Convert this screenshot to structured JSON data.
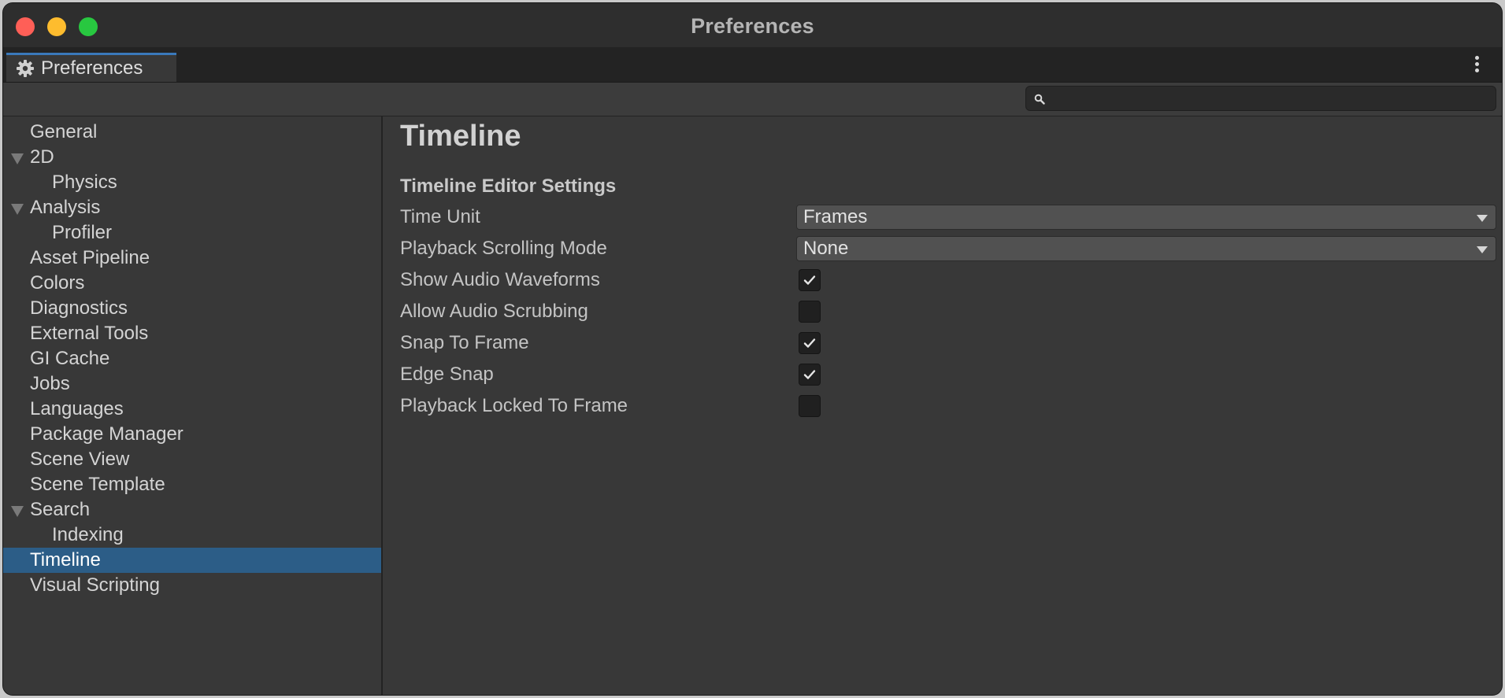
{
  "window": {
    "title": "Preferences"
  },
  "tab": {
    "label": "Preferences",
    "icon": "gear-icon"
  },
  "search": {
    "value": "",
    "placeholder": ""
  },
  "sidebar": {
    "items": [
      {
        "label": "General",
        "level": 0,
        "expandable": false,
        "selected": false
      },
      {
        "label": "2D",
        "level": 0,
        "expandable": true,
        "selected": false
      },
      {
        "label": "Physics",
        "level": 1,
        "expandable": false,
        "selected": false
      },
      {
        "label": "Analysis",
        "level": 0,
        "expandable": true,
        "selected": false
      },
      {
        "label": "Profiler",
        "level": 1,
        "expandable": false,
        "selected": false
      },
      {
        "label": "Asset Pipeline",
        "level": 0,
        "expandable": false,
        "selected": false
      },
      {
        "label": "Colors",
        "level": 0,
        "expandable": false,
        "selected": false
      },
      {
        "label": "Diagnostics",
        "level": 0,
        "expandable": false,
        "selected": false
      },
      {
        "label": "External Tools",
        "level": 0,
        "expandable": false,
        "selected": false
      },
      {
        "label": "GI Cache",
        "level": 0,
        "expandable": false,
        "selected": false
      },
      {
        "label": "Jobs",
        "level": 0,
        "expandable": false,
        "selected": false
      },
      {
        "label": "Languages",
        "level": 0,
        "expandable": false,
        "selected": false
      },
      {
        "label": "Package Manager",
        "level": 0,
        "expandable": false,
        "selected": false
      },
      {
        "label": "Scene View",
        "level": 0,
        "expandable": false,
        "selected": false
      },
      {
        "label": "Scene Template",
        "level": 0,
        "expandable": false,
        "selected": false
      },
      {
        "label": "Search",
        "level": 0,
        "expandable": true,
        "selected": false
      },
      {
        "label": "Indexing",
        "level": 1,
        "expandable": false,
        "selected": false
      },
      {
        "label": "Timeline",
        "level": 0,
        "expandable": false,
        "selected": true
      },
      {
        "label": "Visual Scripting",
        "level": 0,
        "expandable": false,
        "selected": false
      }
    ]
  },
  "main": {
    "title": "Timeline",
    "section_title": "Timeline Editor Settings",
    "rows": [
      {
        "label": "Time Unit",
        "type": "dropdown",
        "value": "Frames"
      },
      {
        "label": "Playback Scrolling Mode",
        "type": "dropdown",
        "value": "None"
      },
      {
        "label": "Show Audio Waveforms",
        "type": "checkbox",
        "checked": true
      },
      {
        "label": "Allow Audio Scrubbing",
        "type": "checkbox",
        "checked": false
      },
      {
        "label": "Snap To Frame",
        "type": "checkbox",
        "checked": true
      },
      {
        "label": "Edge Snap",
        "type": "checkbox",
        "checked": true
      },
      {
        "label": "Playback Locked To Frame",
        "type": "checkbox",
        "checked": false
      }
    ]
  },
  "colors": {
    "window_bg": "#383838",
    "selection": "#2c5d87",
    "tab_accent": "#3a79bb",
    "close": "#ff5f57",
    "minimize": "#febc2e",
    "maximize": "#28c840"
  }
}
